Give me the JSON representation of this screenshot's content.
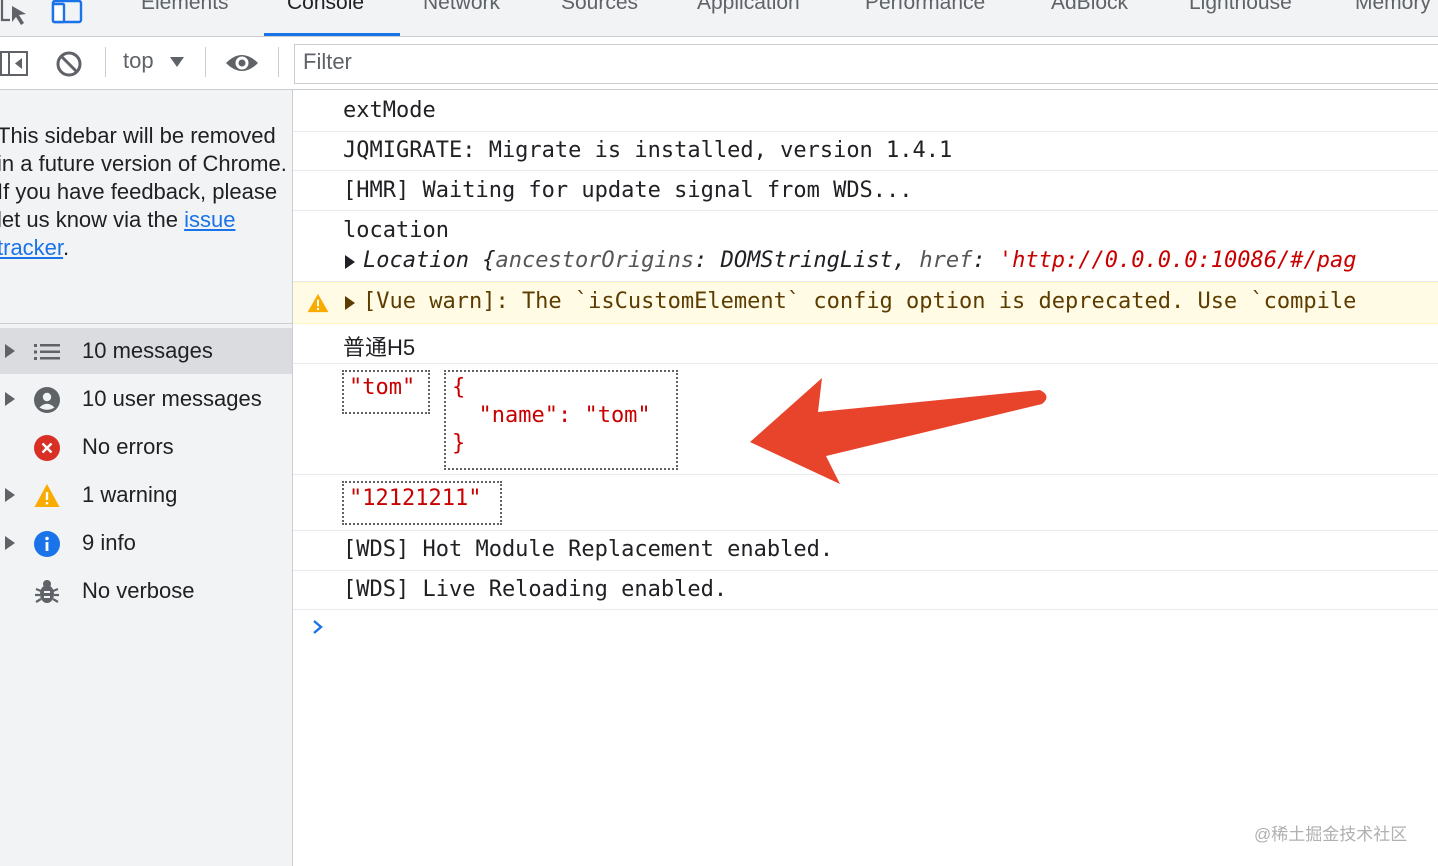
{
  "tabs": [
    {
      "label": "Elements",
      "active": false
    },
    {
      "label": "Console",
      "active": true
    },
    {
      "label": "Network",
      "active": false
    },
    {
      "label": "Sources",
      "active": false
    },
    {
      "label": "Application",
      "active": false
    },
    {
      "label": "Performance",
      "active": false
    },
    {
      "label": "AdBlock",
      "active": false
    },
    {
      "label": "Lighthouse",
      "active": false
    },
    {
      "label": "Memory",
      "active": false
    }
  ],
  "toolbar": {
    "context": "top",
    "filter_placeholder": "Filter",
    "icons": [
      "sidebar-toggle-icon",
      "clear-console-icon",
      "dropdown-arrow-icon",
      "eye-icon"
    ]
  },
  "sidebar": {
    "notice_text": "This sidebar will be removed in a future version of Chrome. If you have feedback, please let us know via the ",
    "notice_link": "issue tracker",
    "notice_end": ".",
    "filters": [
      {
        "label": "10 messages",
        "icon": "list-icon",
        "expandable": true,
        "selected": true
      },
      {
        "label": "10 user messages",
        "icon": "user-icon",
        "expandable": true,
        "selected": false
      },
      {
        "label": "No errors",
        "icon": "error-icon",
        "expandable": false,
        "selected": false
      },
      {
        "label": "1 warning",
        "icon": "warning-icon",
        "expandable": true,
        "selected": false
      },
      {
        "label": "9 info",
        "icon": "info-icon",
        "expandable": true,
        "selected": false
      },
      {
        "label": "No verbose",
        "icon": "bug-icon",
        "expandable": false,
        "selected": false
      }
    ]
  },
  "console": {
    "messages": [
      {
        "text": "extMode"
      },
      {
        "text": "JQMIGRATE: Migrate is installed, version 1.4.1"
      },
      {
        "text": "[HMR] Waiting for update signal from WDS..."
      },
      {
        "text": "location",
        "object": {
          "class_name": "Location",
          "key1": "ancestorOrigins",
          "val1": "DOMStringList",
          "key2": "href",
          "val2": "'http://0.0.0.0:10086/#/pag"
        }
      },
      {
        "text": "[Vue warn]: The `isCustomElement` config option is deprecated. Use `compile",
        "level": "warning"
      },
      {
        "text": "普通H5"
      },
      {
        "string_value": "\"tom\"",
        "object_lines": [
          "{",
          "  \"name\": \"tom\"",
          "}"
        ]
      },
      {
        "string_value": "\"12121211\""
      },
      {
        "text": "[WDS] Hot Module Replacement enabled."
      },
      {
        "text": "[WDS] Live Reloading enabled."
      }
    ]
  },
  "colors": {
    "accent": "#1a73e8",
    "string": "#c80000",
    "warning_bg": "#fffbe5",
    "warning_text": "#5c3c00",
    "arrow": "#e8432b",
    "error": "#d93025",
    "warning_icon": "#f9ab00"
  },
  "watermark": "@稀土掘金技术社区"
}
